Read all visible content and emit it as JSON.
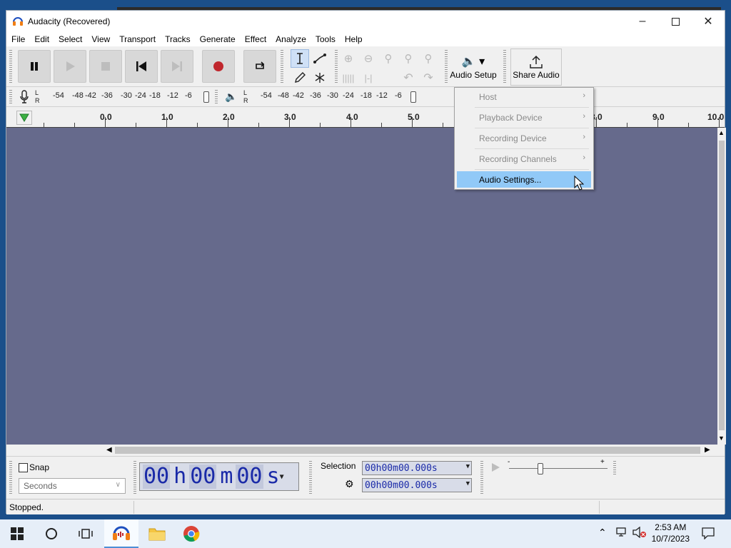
{
  "window": {
    "title": "Audacity (Recovered)"
  },
  "menu": [
    "File",
    "Edit",
    "Select",
    "View",
    "Transport",
    "Tracks",
    "Generate",
    "Effect",
    "Analyze",
    "Tools",
    "Help"
  ],
  "toolbar": {
    "audio_setup_label": "Audio Setup",
    "share_audio_label": "Share Audio"
  },
  "meters": {
    "record_scale": [
      "-54",
      "-48",
      "-42",
      "-36",
      "-30",
      "-24",
      "-18",
      "-12",
      "-6"
    ],
    "playback_scale": [
      "-54",
      "-48",
      "-42",
      "-36",
      "-30",
      "-24",
      "-18",
      "-12",
      "-6"
    ],
    "l": "L",
    "r": "R"
  },
  "timeline": {
    "labels": [
      "0.0",
      "1.0",
      "2.0",
      "3.0",
      "4.0",
      "5.0",
      "8.0",
      "9.0",
      "10.0"
    ]
  },
  "dropdown": {
    "items": [
      {
        "label": "Host",
        "submenu": true
      },
      {
        "label": "Playback Device",
        "submenu": true
      },
      {
        "label": "Recording Device",
        "submenu": true
      },
      {
        "label": "Recording Channels",
        "submenu": true
      },
      {
        "label": "Audio Settings...",
        "submenu": false,
        "highlighted": true
      }
    ]
  },
  "bottom": {
    "snap_label": "Snap",
    "snap_unit": "Seconds",
    "time": {
      "h": "00",
      "h_unit": "h",
      "m": "00",
      "m_unit": "m",
      "s": "00",
      "s_unit": "s"
    },
    "selection_label": "Selection",
    "sel_start": "00h00m00.000s",
    "sel_end": "00h00m00.000s"
  },
  "status": {
    "text": "Stopped."
  },
  "taskbar": {
    "time": "2:53 AM",
    "date": "10/7/2023"
  },
  "colors": {
    "track_bg": "#666a8c",
    "highlight": "#91c9f7",
    "record": "#c0272d"
  }
}
